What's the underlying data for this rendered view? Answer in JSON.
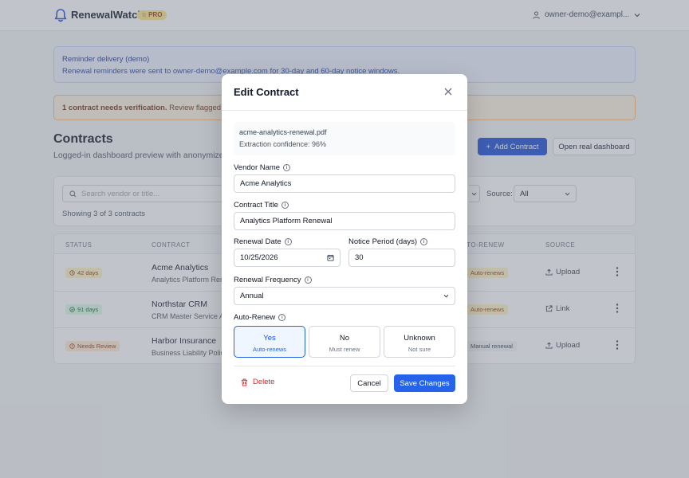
{
  "app": {
    "brand": "RenewalWatch",
    "plan_badge": "PRO",
    "user_email": "owner-demo@exampl..."
  },
  "alerts": {
    "info_title": "Reminder delivery (demo)",
    "info_text": "Renewal reminders were sent to owner-demo@example.com for 30-day and 60-day notice windows.",
    "warn_bold": "1 contract needs verification.",
    "warn_text": " Review flagged field"
  },
  "page": {
    "title": "Contracts",
    "subtitle": "Logged-in dashboard preview with anonymized",
    "add_button": "Add Contract",
    "open_button": "Open real dashboard"
  },
  "filters": {
    "search_placeholder": "Search vendor or title...",
    "source_label": "Source:",
    "source_value": "All",
    "showing": "Showing 3 of 3 contracts"
  },
  "table": {
    "headers": {
      "status": "STATUS",
      "contract": "CONTRACT",
      "auto_renew": "AUTO-RENEW",
      "source": "SOURCE"
    },
    "rows": [
      {
        "status": "42 days",
        "vendor": "Acme Analytics",
        "title": "Analytics Platform Rene",
        "auto_renew": "Auto-renews",
        "source": "Upload"
      },
      {
        "status": "91 days",
        "vendor": "Northstar CRM",
        "title": "CRM Master Service A",
        "auto_renew": "Auto-renews",
        "source": "Link"
      },
      {
        "status": "Needs Review",
        "vendor": "Harbor Insurance",
        "title": "Business Liability Polic",
        "auto_renew": "Manual renewal",
        "source": "Upload"
      }
    ]
  },
  "modal": {
    "title": "Edit Contract",
    "file_name": "acme-analytics-renewal.pdf",
    "confidence": "Extraction confidence: 96%",
    "vendor_label": "Vendor Name",
    "vendor_value": "Acme Analytics",
    "title_label": "Contract Title",
    "title_value": "Analytics Platform Renewal",
    "renewal_date_label": "Renewal Date",
    "renewal_date_value": "10/25/2026",
    "notice_label": "Notice Period (days)",
    "notice_value": "30",
    "frequency_label": "Renewal Frequency",
    "frequency_value": "Annual",
    "auto_renew_label": "Auto-Renew",
    "options": [
      {
        "label": "Yes",
        "sub": "Auto-renews"
      },
      {
        "label": "No",
        "sub": "Must renew"
      },
      {
        "label": "Unknown",
        "sub": "Not sure"
      }
    ],
    "delete": "Delete",
    "cancel": "Cancel",
    "save": "Save Changes"
  },
  "colors": {
    "primary": "#2563eb",
    "danger": "#dc2626",
    "pro_badge": "#fde68a"
  },
  "icons": [
    "bell-icon",
    "star-icon",
    "user-icon",
    "chevron-down-icon",
    "plus-icon",
    "search-icon",
    "clock-icon",
    "check-circle-icon",
    "alert-circle-icon",
    "upload-icon",
    "external-link-icon",
    "kebab-icon",
    "close-icon",
    "info-icon",
    "calendar-icon",
    "trash-icon"
  ]
}
